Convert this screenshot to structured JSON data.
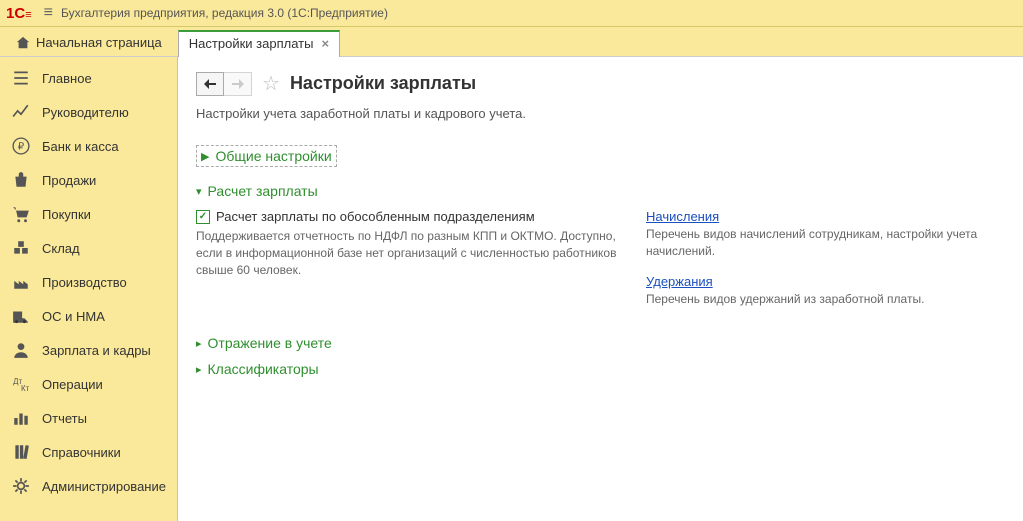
{
  "titlebar": {
    "app_title": "Бухгалтерия предприятия, редакция 3.0  (1С:Предприятие)"
  },
  "tabs": {
    "home_label": "Начальная страница",
    "active_label": "Настройки зарплаты"
  },
  "sidebar": {
    "items": [
      {
        "label": "Главное"
      },
      {
        "label": "Руководителю"
      },
      {
        "label": "Банк и касса"
      },
      {
        "label": "Продажи"
      },
      {
        "label": "Покупки"
      },
      {
        "label": "Склад"
      },
      {
        "label": "Производство"
      },
      {
        "label": "ОС и НМА"
      },
      {
        "label": "Зарплата и кадры"
      },
      {
        "label": "Операции"
      },
      {
        "label": "Отчеты"
      },
      {
        "label": "Справочники"
      },
      {
        "label": "Администрирование"
      }
    ]
  },
  "page": {
    "title": "Настройки зарплаты",
    "subtitle": "Настройки учета заработной платы и кадрового учета.",
    "section_common": "Общие настройки",
    "section_calc": "Расчет зарплаты",
    "checkbox_label": "Расчет зарплаты по обособленным подразделениям",
    "checkbox_hint": "Поддерживается отчетность по НДФЛ по разным КПП и ОКТМО. Доступно, если в информационной базе нет организаций с численностью работников свыше 60 человек.",
    "link_accruals": "Начисления",
    "hint_accruals": "Перечень видов начислений сотрудникам, настройки учета начислений.",
    "link_deductions": "Удержания",
    "hint_deductions": "Перечень видов удержаний из заработной платы.",
    "section_reflect": "Отражение в учете",
    "section_classifiers": "Классификаторы"
  }
}
